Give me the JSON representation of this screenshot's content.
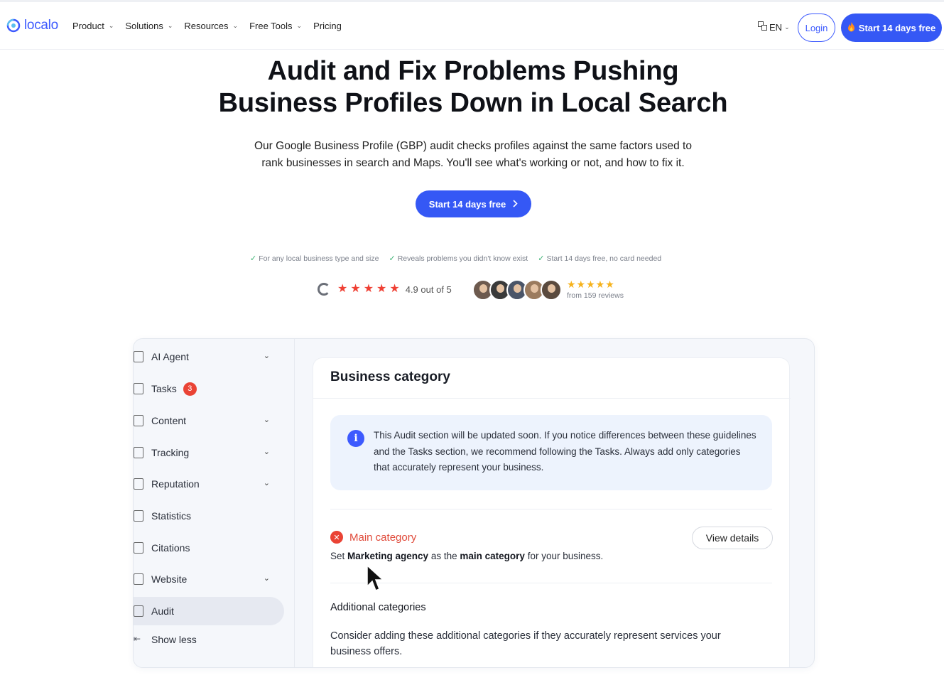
{
  "nav": {
    "logo_text": "localo",
    "menu": [
      {
        "label": "Product",
        "has_dropdown": true
      },
      {
        "label": "Solutions",
        "has_dropdown": true
      },
      {
        "label": "Resources",
        "has_dropdown": true
      },
      {
        "label": "Free Tools",
        "has_dropdown": true
      },
      {
        "label": "Pricing",
        "has_dropdown": false
      }
    ],
    "language": "EN",
    "login_label": "Login",
    "start_label": "Start 14 days free",
    "accent_color": "#3558f5"
  },
  "hero": {
    "title_line1": "Audit and Fix Problems Pushing",
    "title_line2": "Business Profiles Down in Local Search",
    "subtitle_line1": "Our Google Business Profile (GBP) audit checks profiles against the same factors used to",
    "subtitle_line2": "rank businesses in search and Maps. You'll see what's working or not, and how to fix it.",
    "cta_label": "Start 14 days free"
  },
  "checks": [
    "For any local business type and size",
    "Reveals problems you didn't know exist",
    "Start 14 days free, no card needed"
  ],
  "rating": {
    "g2_text": "4.9 out of 5",
    "stars": 5,
    "reviews_text": "from 159 reviews",
    "avatar_count": 5
  },
  "sidebar": {
    "items": [
      {
        "label": "AI Agent",
        "icon": "ai-agent-icon",
        "has_chevron": true
      },
      {
        "label": "Tasks",
        "icon": "tasks-icon",
        "has_chevron": false,
        "badge": "3"
      },
      {
        "label": "Content",
        "icon": "content-icon",
        "has_chevron": true
      },
      {
        "label": "Tracking",
        "icon": "tracking-icon",
        "has_chevron": true
      },
      {
        "label": "Reputation",
        "icon": "reputation-icon",
        "has_chevron": true
      },
      {
        "label": "Statistics",
        "icon": "statistics-icon",
        "has_chevron": false
      },
      {
        "label": "Citations",
        "icon": "citations-icon",
        "has_chevron": false
      },
      {
        "label": "Website",
        "icon": "website-icon",
        "has_chevron": true
      },
      {
        "label": "Audit",
        "icon": "audit-icon",
        "has_chevron": false,
        "active": true
      },
      {
        "label": "Show less",
        "icon": "collapse-icon",
        "has_chevron": false
      }
    ]
  },
  "panel": {
    "title": "Business category",
    "info_text": "This Audit section will be updated soon. If you notice differences between these guidelines and the Tasks section, we recommend following the Tasks. Always add only categories that accurately represent your business.",
    "main_category_label": "Main category",
    "view_details_label": "View details",
    "set_prefix": "Set",
    "set_value": "Marketing agency",
    "set_middle": "as the",
    "set_target": "main category",
    "set_suffix": "for your business.",
    "additional_title": "Additional categories",
    "additional_text": "Consider adding these additional categories if they accurately represent services your business offers."
  }
}
